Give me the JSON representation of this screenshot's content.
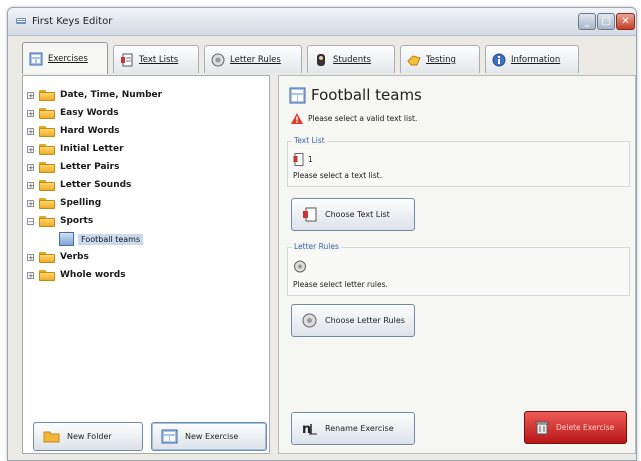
{
  "window": {
    "title": "First Keys Editor"
  },
  "tabs": [
    {
      "label": "Exercises",
      "icon": "exercise-grid-icon",
      "active": true
    },
    {
      "label": "Text Lists",
      "icon": "document-icon",
      "active": false
    },
    {
      "label": "Letter Rules",
      "icon": "letter-dial-icon",
      "active": false
    },
    {
      "label": "Students",
      "icon": "student-icon",
      "active": false
    },
    {
      "label": "Testing",
      "icon": "testing-hand-icon",
      "active": false
    },
    {
      "label": "Information",
      "icon": "info-icon",
      "active": false
    }
  ],
  "tree": [
    {
      "label": "Date, Time, Number",
      "expander": "+"
    },
    {
      "label": "Easy Words",
      "expander": "+"
    },
    {
      "label": "Hard Words",
      "expander": "+"
    },
    {
      "label": "Initial Letter",
      "expander": "+"
    },
    {
      "label": "Letter Pairs",
      "expander": "+"
    },
    {
      "label": "Letter Sounds",
      "expander": "+"
    },
    {
      "label": "Spelling",
      "expander": "+"
    },
    {
      "label": "Sports",
      "expander": "−",
      "children": [
        {
          "label": "Football teams",
          "selected": true
        }
      ]
    },
    {
      "label": "Verbs",
      "expander": "+"
    },
    {
      "label": "Whole words",
      "expander": "+"
    }
  ],
  "left_buttons": {
    "new_folder": "New Folder",
    "new_exercise": "New Exercise"
  },
  "exercise": {
    "title": "Football teams",
    "warning": "Please select a valid text list.",
    "text_list": {
      "group_label": "Text List",
      "count": "1",
      "status": "Please select a text list.",
      "button": "Choose Text List"
    },
    "letter_rules": {
      "group_label": "Letter Rules",
      "status": "Please select letter rules.",
      "button": "Choose Letter Rules"
    },
    "rename_button": "Rename Exercise",
    "delete_button": "Delete Exercise"
  },
  "colors": {
    "accent": "#3c63a8",
    "selection": "#c9d9ee",
    "delete": "#c21d1d",
    "folder": "#f0ae2c"
  }
}
